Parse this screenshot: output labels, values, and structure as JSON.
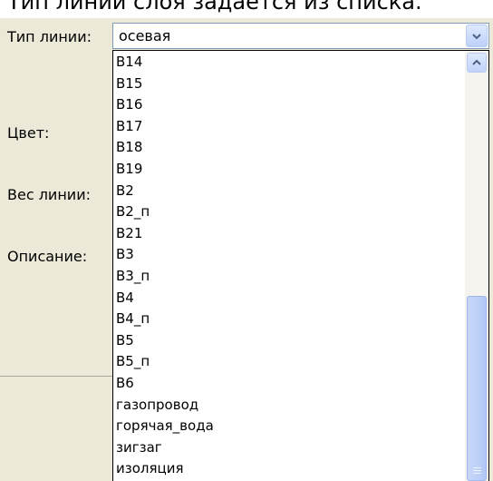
{
  "caption": "Тип линии слоя задается из списка.",
  "form": {
    "labels": {
      "line_type": "Тип линии:",
      "color": "Цвет:",
      "weight": "Вес линии:",
      "description": "Описание:"
    },
    "line_type_combo": {
      "value": "осевая"
    }
  },
  "dropdown": {
    "options": [
      "B14",
      "B15",
      "B16",
      "B17",
      "B18",
      "B19",
      "B2",
      "B2_п",
      "B21",
      "B3",
      "B3_п",
      "B4",
      "B4_п",
      "B5",
      "B5_п",
      "B6",
      "газопровод",
      "горячая_вода",
      "зигзаг",
      "изоляция"
    ]
  },
  "colors": {
    "dialog_bg": "#ece9d8",
    "scroll_accent": "#bcd0f8",
    "arrow": "#4d6185"
  },
  "icons": {
    "combo_arrow": "chevron-down-icon",
    "scroll_up": "chevron-up-icon"
  }
}
